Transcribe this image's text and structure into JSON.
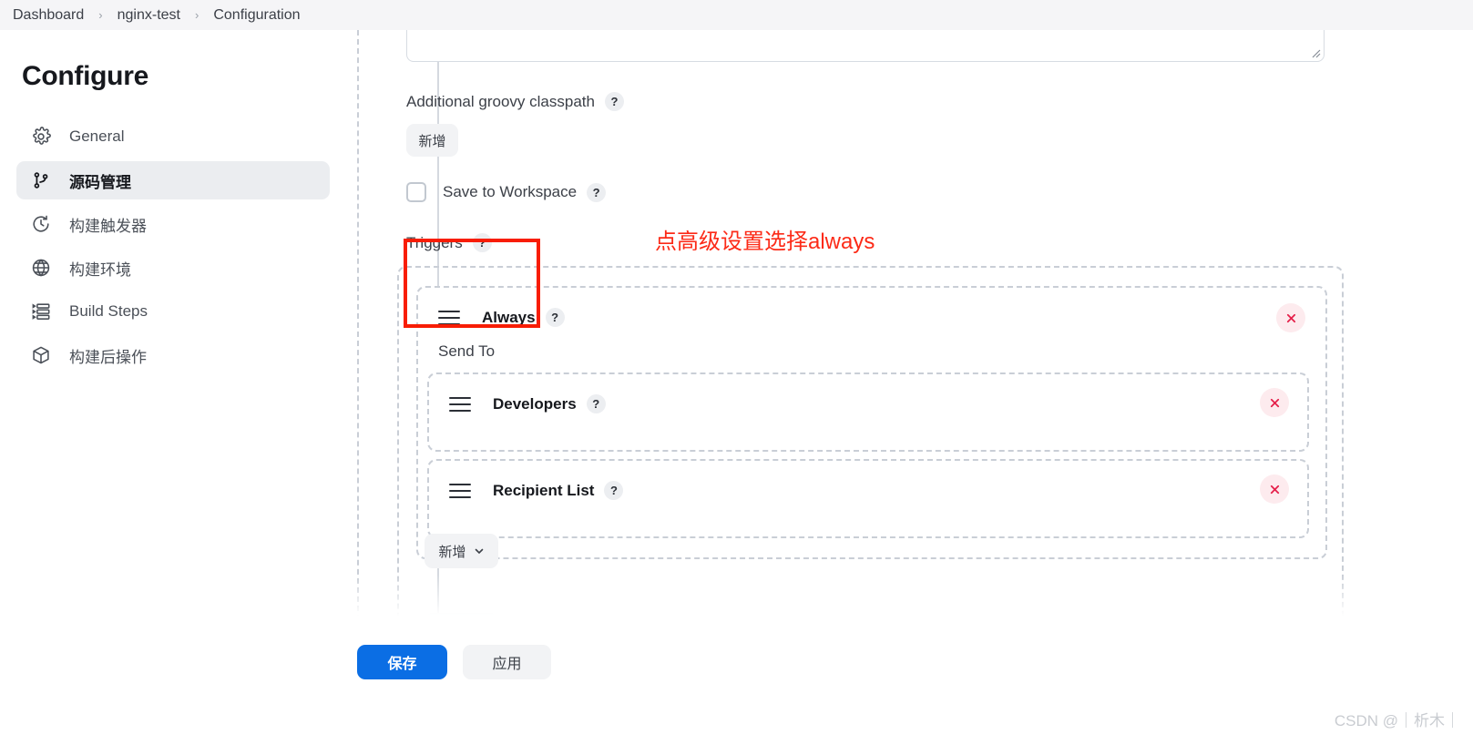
{
  "breadcrumb": {
    "separator": "›",
    "items": [
      {
        "label": "Dashboard"
      },
      {
        "label": "nginx-test"
      },
      {
        "label": "Configuration"
      }
    ]
  },
  "sidebar": {
    "title": "Configure",
    "items": [
      {
        "label": "General",
        "icon": "gear-icon",
        "active": false
      },
      {
        "label": "源码管理",
        "icon": "source-control-icon",
        "active": true
      },
      {
        "label": "构建触发器",
        "icon": "clock-icon",
        "active": false
      },
      {
        "label": "构建环境",
        "icon": "globe-icon",
        "active": false
      },
      {
        "label": "Build Steps",
        "icon": "list-icon",
        "active": false
      },
      {
        "label": "构建后操作",
        "icon": "package-icon",
        "active": false
      }
    ]
  },
  "main": {
    "help_badge": "?",
    "groovy_classpath": {
      "label": "Additional groovy classpath",
      "add_button": "新增"
    },
    "save_to_workspace": {
      "label": "Save to Workspace",
      "checked": false
    },
    "triggers": {
      "label": "Triggers",
      "entries": [
        {
          "title": "Always",
          "delete_icon": "close-icon"
        }
      ],
      "send_to": {
        "label": "Send To",
        "entries": [
          {
            "title": "Developers",
            "delete_icon": "close-icon"
          },
          {
            "title": "Recipient List",
            "delete_icon": "close-icon"
          }
        ],
        "add_button": "新增",
        "add_button_caret": "chevron-down-icon"
      }
    }
  },
  "annotation": {
    "text": "点高级设置选择always",
    "color": "#fc2a17"
  },
  "footer": {
    "save_label": "保存",
    "apply_label": "应用",
    "save_color": "#0b6ee4",
    "watermark": "CSDN @｜析木｜"
  }
}
